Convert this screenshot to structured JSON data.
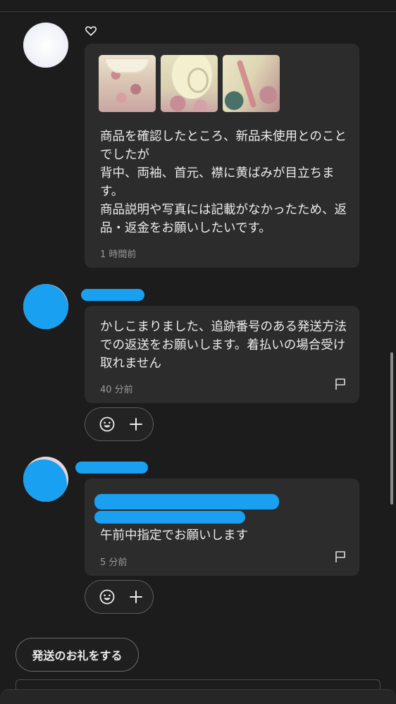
{
  "messages": [
    {
      "text": "商品を確認したところ、新品未使用とのことでしたが\n背中、両袖、首元、襟に黄ばみが目立ちます。\n商品説明や写真には記載がなかったため、返品・返金をお願いしたいです。",
      "time": "1 時間前",
      "liked_icon": "heart-outline-icon",
      "photos": [
        "item-photo-collar",
        "item-photo-sleeve",
        "item-photo-back"
      ]
    },
    {
      "text": "かしこまりました、追跡番号のある発送方法での返送をお願いします。着払いの場合受け取れません",
      "time": "40 分前"
    },
    {
      "text": "午前中指定でお願いします",
      "time": "5 分前"
    }
  ],
  "actions": {
    "send_thanks": "発送のお礼をする"
  },
  "colors": {
    "background": "#1c1c1c",
    "bubble": "#2c2c2c",
    "redaction": "#1aa0f0"
  }
}
